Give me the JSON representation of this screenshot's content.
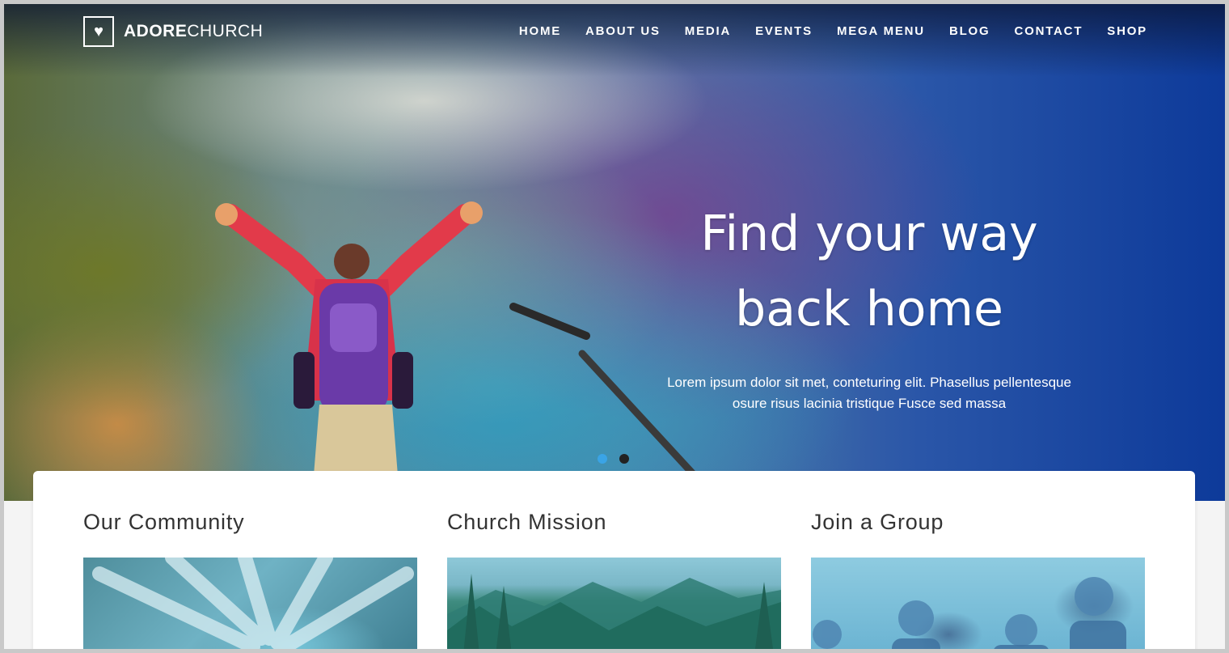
{
  "brand": {
    "logo_icon": "heart-icon",
    "name_bold": "ADORE",
    "name_light": "CHURCH"
  },
  "nav": {
    "items": [
      "HOME",
      "ABOUT US",
      "MEDIA",
      "EVENTS",
      "MEGA MENU",
      "BLOG",
      "CONTACT",
      "SHOP"
    ]
  },
  "hero": {
    "title_line1": "Find your way",
    "title_line2": "back home",
    "subtitle_line1": "Lorem ipsum dolor sit met, conteturing elit. Phasellus pellentesque",
    "subtitle_line2": "osure risus lacinia tristique Fusce sed massa",
    "slides": 2,
    "active_slide": 1
  },
  "features": [
    {
      "title": "Our Community"
    },
    {
      "title": "Church Mission"
    },
    {
      "title": "Join a Group"
    }
  ],
  "colors": {
    "active_dot": "#3aa4e6",
    "inactive_dot": "#222222",
    "heading_text": "#333333"
  }
}
